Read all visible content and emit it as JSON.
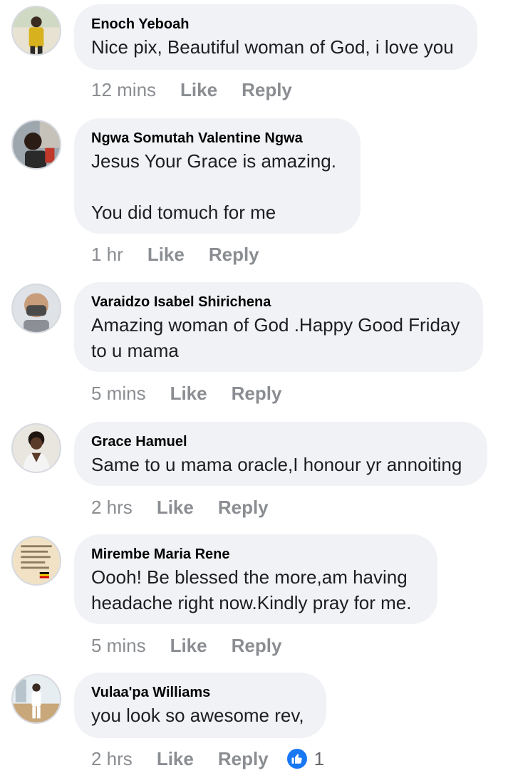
{
  "comments": [
    {
      "author": "Enoch Yeboah",
      "text": "Nice pix, Beautiful woman of God, i love you",
      "time": "12 mins",
      "like_label": "Like",
      "reply_label": "Reply"
    },
    {
      "author": "Ngwa Somutah Valentine Ngwa",
      "text": "Jesus Your Grace is amazing.\n\nYou did tomuch for me",
      "time": "1 hr",
      "like_label": "Like",
      "reply_label": "Reply"
    },
    {
      "author": "Varaidzo Isabel Shirichena",
      "text": "Amazing woman of God .Happy Good Friday\nto u mama",
      "time": "5 mins",
      "like_label": "Like",
      "reply_label": "Reply"
    },
    {
      "author": "Grace Hamuel",
      "text": "Same to u mama oracle,I honour yr annoiting",
      "time": "2 hrs",
      "like_label": "Like",
      "reply_label": "Reply"
    },
    {
      "author": "Mirembe Maria Rene",
      "text": "Oooh! Be blessed the more,am having\nheadache right now.Kindly pray for me.",
      "time": "5 mins",
      "like_label": "Like",
      "reply_label": "Reply"
    },
    {
      "author": "Vulaa'pa Williams",
      "text": "you look so awesome rev,",
      "time": "2 hrs",
      "like_label": "Like",
      "reply_label": "Reply",
      "reaction_icon": "thumbs-up-icon",
      "reaction_count": "1"
    }
  ],
  "colors": {
    "bubble": "#f0f2f5",
    "action_text": "#8a8d91",
    "like_blue": "#1877f2"
  }
}
